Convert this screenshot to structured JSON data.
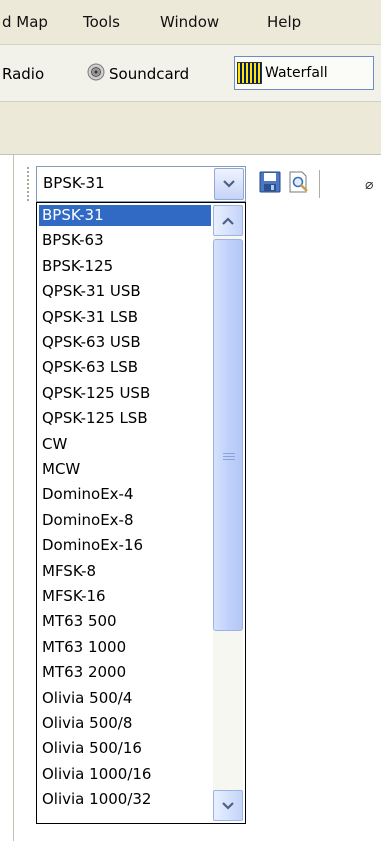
{
  "menu": {
    "items": [
      "d Map",
      "Tools",
      "Window",
      "Help"
    ]
  },
  "toolbar": {
    "radio_label": "Radio",
    "soundcard_label": "Soundcard",
    "waterfall_label": "Waterfall"
  },
  "mode_combo": {
    "value": "BPSK-31",
    "options": [
      "BPSK-31",
      "BPSK-63",
      "BPSK-125",
      "QPSK-31 USB",
      "QPSK-31 LSB",
      "QPSK-63 USB",
      "QPSK-63 LSB",
      "QPSK-125 USB",
      "QPSK-125 LSB",
      "CW",
      "MCW",
      "DominoEx-4",
      "DominoEx-8",
      "DominoEx-16",
      "MFSK-8",
      "MFSK-16",
      "MT63 500",
      "MT63 1000",
      "MT63 2000",
      "Olivia 500/4",
      "Olivia 500/8",
      "Olivia 500/16",
      "Olivia 1000/16",
      "Olivia 1000/32"
    ],
    "selected_index": 0
  },
  "icons": {
    "combo_arrow": "chevron-down-icon",
    "save": "save-icon",
    "print_preview": "print-preview-icon",
    "scroll_up": "scroll-up-icon",
    "scroll_down": "scroll-down-icon",
    "soundcard": "speaker-icon",
    "waterfall": "waterfall-icon"
  },
  "colors": {
    "selection": "#316ac5",
    "menu_bg": "#ece9d8",
    "combo_border": "#7f9db9"
  }
}
